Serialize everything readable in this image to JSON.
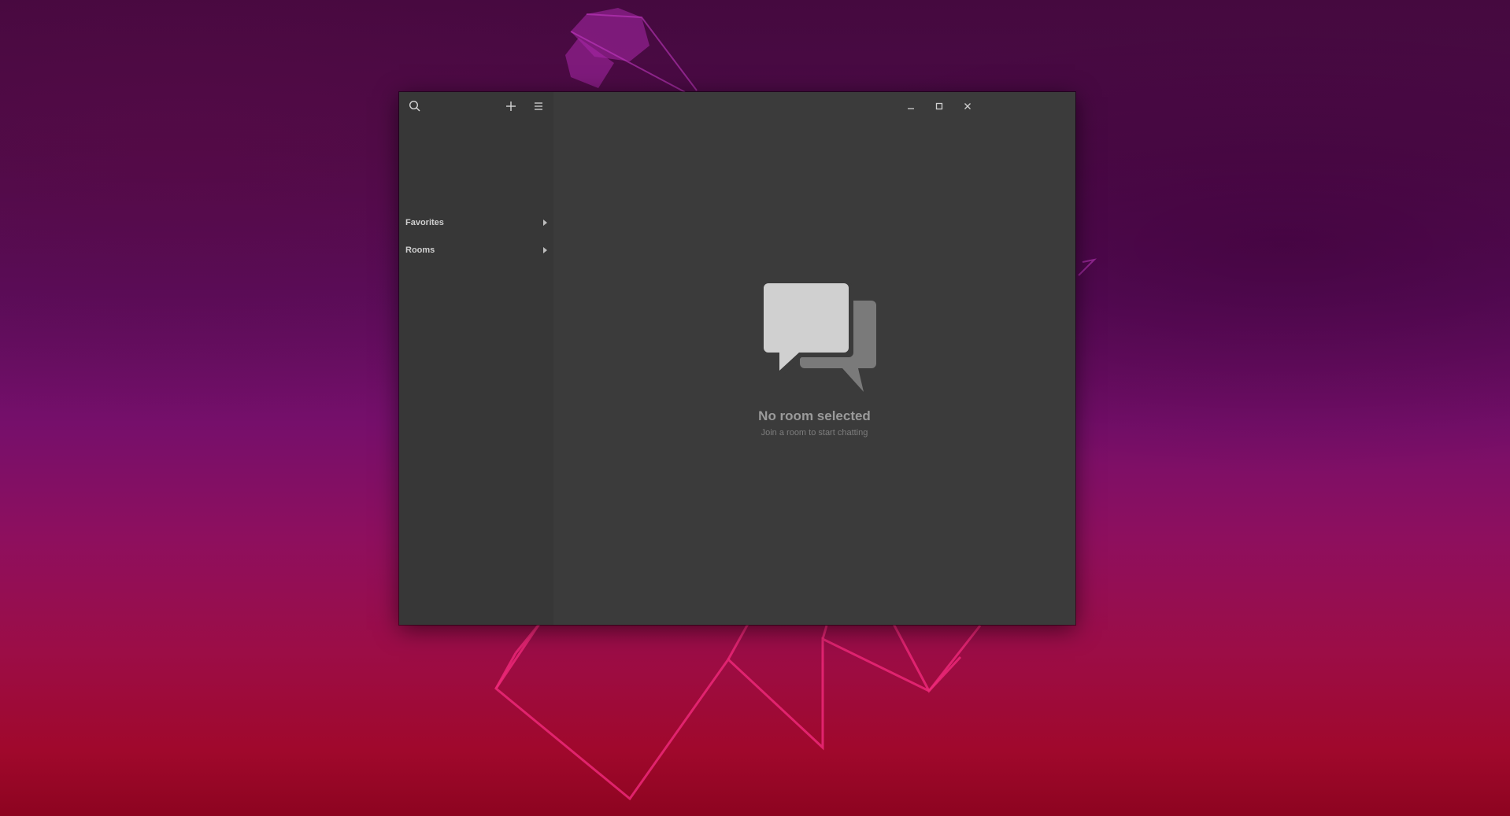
{
  "window": {
    "controls": {
      "minimize_icon": "minimize-icon",
      "maximize_icon": "maximize-icon",
      "close_icon": "close-icon"
    }
  },
  "sidebar": {
    "toolbar": {
      "search_icon": "search-icon",
      "add_icon": "plus-icon",
      "menu_icon": "hamburger-menu-icon"
    },
    "sections": [
      {
        "label": "Favorites",
        "expanded": false
      },
      {
        "label": "Rooms",
        "expanded": false
      }
    ]
  },
  "main": {
    "empty_state": {
      "icon": "chat-bubbles-icon",
      "title": "No room selected",
      "subtitle": "Join a room to start chatting"
    }
  },
  "colors": {
    "window_bg": "#3b3b3b",
    "sidebar_bg": "#373737",
    "wallpaper_top": "#45093f",
    "wallpaper_bottom": "#a0082c",
    "wallpaper_lines": "#e0247a"
  }
}
